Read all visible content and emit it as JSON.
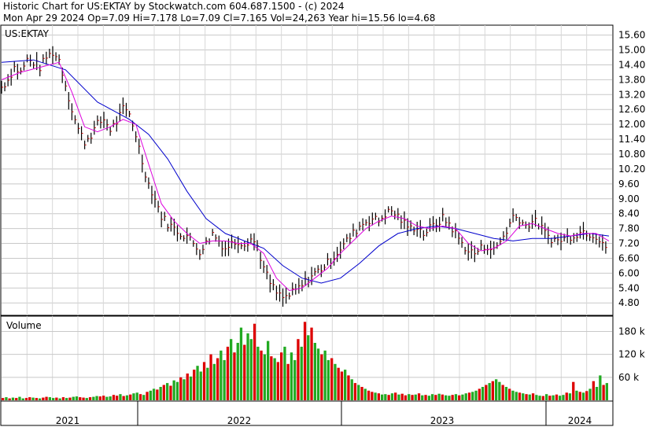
{
  "header": {
    "line1": "Historic Chart for US:EKTAY by Stockwatch.com 604.687.1500 - (c) 2024",
    "line2": "Mon Apr 29 2024  Op=7.09  Hi=7.178  Lo=7.09  Cl=7.165  Vol=24,263  Year hi=15.56  lo=4.68"
  },
  "chart_data": [
    {
      "type": "line",
      "subtype": "ohlc-bars-with-moving-averages",
      "title": "US:EKTAY",
      "ylim": [
        4.3,
        16.0
      ],
      "y_ticks": [
        4.8,
        5.4,
        6.0,
        6.6,
        7.2,
        7.8,
        8.4,
        9.0,
        9.6,
        10.2,
        10.8,
        11.4,
        12.0,
        12.6,
        13.2,
        13.8,
        14.4,
        15.0,
        15.6
      ],
      "y_tick_labels": [
        "4.80",
        "5.40",
        "6.00",
        "6.60",
        "7.20",
        "7.80",
        "8.40",
        "9.00",
        "9.60",
        "10.20",
        "10.80",
        "11.40",
        "12.00",
        "12.60",
        "13.20",
        "13.80",
        "14.40",
        "15.00",
        "15.60"
      ],
      "x_range": [
        0,
        100
      ],
      "grid": true,
      "colors": {
        "bars": "#000000",
        "bar_ticks": "#cc0000",
        "ma_short": "#dd00dd",
        "ma_long": "#0000cc",
        "grid": "#c8c8c8"
      },
      "price": [
        [
          0,
          13.5
        ],
        [
          2,
          13.8
        ],
        [
          4,
          14.3
        ],
        [
          6,
          14.1
        ],
        [
          8,
          14.6
        ],
        [
          10,
          14.5
        ],
        [
          12,
          14.3
        ],
        [
          14,
          14.7
        ],
        [
          16,
          14.9
        ],
        [
          18,
          14.6
        ],
        [
          20,
          13.6
        ],
        [
          22,
          12.6
        ],
        [
          24,
          11.8
        ],
        [
          26,
          11.3
        ],
        [
          28,
          11.6
        ],
        [
          30,
          12.0
        ],
        [
          32,
          12.2
        ],
        [
          34,
          11.8
        ],
        [
          36,
          12.1
        ],
        [
          38,
          12.6
        ],
        [
          40,
          12.4
        ],
        [
          42,
          11.6
        ],
        [
          44,
          10.5
        ],
        [
          46,
          9.6
        ],
        [
          48,
          9.0
        ],
        [
          50,
          8.3
        ],
        [
          52,
          8.0
        ],
        [
          54,
          7.8
        ],
        [
          56,
          7.6
        ],
        [
          58,
          7.5
        ],
        [
          60,
          7.2
        ],
        [
          62,
          6.9
        ],
        [
          64,
          7.2
        ],
        [
          66,
          7.6
        ],
        [
          68,
          7.3
        ],
        [
          70,
          7.0
        ],
        [
          72,
          7.2
        ],
        [
          74,
          7.3
        ],
        [
          76,
          7.2
        ],
        [
          78,
          7.4
        ],
        [
          80,
          7.1
        ],
        [
          82,
          6.2
        ],
        [
          84,
          5.6
        ],
        [
          86,
          5.2
        ],
        [
          88,
          5.0
        ],
        [
          90,
          5.1
        ],
        [
          92,
          5.3
        ],
        [
          94,
          5.5
        ],
        [
          96,
          5.8
        ],
        [
          98,
          6.0
        ],
        [
          100,
          6.2
        ],
        [
          102,
          6.4
        ],
        [
          104,
          6.7
        ],
        [
          106,
          7.0
        ],
        [
          108,
          7.3
        ],
        [
          110,
          7.6
        ],
        [
          112,
          7.9
        ],
        [
          114,
          8.1
        ],
        [
          116,
          8.2
        ],
        [
          118,
          8.1
        ],
        [
          120,
          8.4
        ],
        [
          122,
          8.5
        ],
        [
          124,
          8.3
        ],
        [
          126,
          8.0
        ],
        [
          128,
          7.8
        ],
        [
          130,
          7.9
        ],
        [
          132,
          7.6
        ],
        [
          134,
          7.8
        ],
        [
          136,
          8.0
        ],
        [
          138,
          8.2
        ],
        [
          140,
          8.0
        ],
        [
          142,
          7.6
        ],
        [
          144,
          7.2
        ],
        [
          146,
          6.9
        ],
        [
          148,
          6.8
        ],
        [
          150,
          7.0
        ],
        [
          152,
          7.1
        ],
        [
          154,
          6.9
        ],
        [
          156,
          7.3
        ],
        [
          158,
          7.7
        ],
        [
          160,
          8.3
        ],
        [
          162,
          8.2
        ],
        [
          164,
          7.9
        ],
        [
          166,
          8.1
        ],
        [
          168,
          8.0
        ],
        [
          170,
          7.6
        ],
        [
          172,
          7.4
        ],
        [
          174,
          7.3
        ],
        [
          176,
          7.4
        ],
        [
          178,
          7.5
        ],
        [
          180,
          7.6
        ],
        [
          182,
          7.7
        ],
        [
          184,
          7.6
        ],
        [
          186,
          7.5
        ],
        [
          188,
          7.3
        ],
        [
          190,
          6.8
        ]
      ],
      "ma_short": [
        [
          0,
          13.8
        ],
        [
          6,
          14.1
        ],
        [
          12,
          14.3
        ],
        [
          18,
          14.5
        ],
        [
          22,
          13.3
        ],
        [
          26,
          11.9
        ],
        [
          30,
          11.7
        ],
        [
          34,
          11.9
        ],
        [
          38,
          12.2
        ],
        [
          42,
          12.0
        ],
        [
          46,
          10.4
        ],
        [
          50,
          8.8
        ],
        [
          54,
          8.1
        ],
        [
          58,
          7.6
        ],
        [
          62,
          7.2
        ],
        [
          66,
          7.3
        ],
        [
          70,
          7.3
        ],
        [
          74,
          7.2
        ],
        [
          78,
          7.2
        ],
        [
          82,
          6.8
        ],
        [
          86,
          5.8
        ],
        [
          90,
          5.3
        ],
        [
          94,
          5.4
        ],
        [
          98,
          5.8
        ],
        [
          102,
          6.2
        ],
        [
          106,
          6.8
        ],
        [
          110,
          7.3
        ],
        [
          114,
          7.8
        ],
        [
          118,
          8.1
        ],
        [
          122,
          8.3
        ],
        [
          126,
          8.2
        ],
        [
          130,
          7.9
        ],
        [
          134,
          7.8
        ],
        [
          138,
          7.9
        ],
        [
          142,
          7.8
        ],
        [
          146,
          7.2
        ],
        [
          150,
          6.9
        ],
        [
          154,
          7.0
        ],
        [
          158,
          7.3
        ],
        [
          162,
          7.9
        ],
        [
          166,
          8.0
        ],
        [
          170,
          7.8
        ],
        [
          174,
          7.6
        ],
        [
          178,
          7.5
        ],
        [
          182,
          7.6
        ],
        [
          186,
          7.6
        ],
        [
          190,
          7.3
        ]
      ],
      "ma_long": [
        [
          0,
          14.5
        ],
        [
          10,
          14.6
        ],
        [
          20,
          14.2
        ],
        [
          30,
          12.9
        ],
        [
          40,
          12.2
        ],
        [
          46,
          11.6
        ],
        [
          52,
          10.6
        ],
        [
          58,
          9.3
        ],
        [
          64,
          8.2
        ],
        [
          70,
          7.6
        ],
        [
          76,
          7.3
        ],
        [
          82,
          7.0
        ],
        [
          88,
          6.3
        ],
        [
          94,
          5.8
        ],
        [
          100,
          5.6
        ],
        [
          106,
          5.8
        ],
        [
          112,
          6.4
        ],
        [
          118,
          7.1
        ],
        [
          124,
          7.6
        ],
        [
          130,
          7.8
        ],
        [
          136,
          7.9
        ],
        [
          142,
          7.8
        ],
        [
          148,
          7.6
        ],
        [
          154,
          7.4
        ],
        [
          160,
          7.3
        ],
        [
          166,
          7.4
        ],
        [
          172,
          7.4
        ],
        [
          178,
          7.5
        ],
        [
          184,
          7.6
        ],
        [
          190,
          7.5
        ]
      ]
    },
    {
      "type": "bar",
      "title": "Volume",
      "ylim": [
        0,
        220
      ],
      "y_ticks": [
        60,
        120,
        180
      ],
      "y_tick_labels": [
        "60 k",
        "120 k",
        "180 k"
      ],
      "x_ticks_years": [
        "2021",
        "2022",
        "2023",
        "2024"
      ],
      "colors": {
        "up": "#22aa22",
        "down": "#dd0000"
      },
      "volume": [
        6,
        8,
        5,
        7,
        6,
        9,
        5,
        6,
        8,
        7,
        6,
        5,
        7,
        9,
        8,
        6,
        7,
        5,
        8,
        6,
        7,
        9,
        10,
        8,
        7,
        6,
        8,
        9,
        11,
        10,
        12,
        9,
        10,
        14,
        12,
        16,
        11,
        13,
        15,
        18,
        20,
        16,
        14,
        22,
        25,
        30,
        28,
        35,
        40,
        45,
        38,
        52,
        48,
        60,
        55,
        70,
        62,
        80,
        90,
        75,
        100,
        85,
        120,
        95,
        110,
        130,
        105,
        140,
        160,
        125,
        150,
        190,
        145,
        175,
        160,
        200,
        140,
        130,
        120,
        155,
        115,
        110,
        100,
        125,
        140,
        95,
        125,
        105,
        160,
        140,
        205,
        170,
        190,
        150,
        135,
        120,
        130,
        105,
        110,
        95,
        85,
        75,
        80,
        65,
        55,
        45,
        40,
        35,
        30,
        25,
        22,
        20,
        18,
        15,
        16,
        14,
        18,
        20,
        15,
        17,
        13,
        16,
        14,
        15,
        18,
        13,
        14,
        12,
        16,
        14,
        17,
        15,
        13,
        12,
        14,
        16,
        13,
        15,
        18,
        20,
        22,
        25,
        30,
        35,
        40,
        45,
        50,
        55,
        48,
        40,
        35,
        30,
        25,
        22,
        20,
        18,
        16,
        15,
        18,
        14,
        12,
        11,
        16,
        12,
        13,
        15,
        12,
        14,
        20,
        18,
        48,
        25,
        22,
        20,
        24,
        30,
        50,
        35,
        65,
        40,
        45
      ],
      "volume_up": [
        0,
        1,
        0,
        1,
        0,
        1,
        1,
        0,
        0,
        1,
        0,
        1,
        0,
        0,
        1,
        1,
        0,
        1,
        0,
        1,
        0,
        1,
        1,
        0,
        0,
        1,
        0,
        1,
        1,
        0,
        0,
        1,
        1,
        0,
        0,
        1,
        0,
        1,
        0,
        1,
        1,
        0,
        1,
        0,
        1,
        1,
        0,
        1,
        0,
        1,
        0,
        1,
        1,
        0,
        1,
        0,
        1,
        0,
        1,
        1,
        0,
        1,
        0,
        1,
        0,
        1,
        1,
        0,
        1,
        0,
        1,
        1,
        0,
        1,
        1,
        0,
        1,
        0,
        1,
        1,
        0,
        1,
        0,
        0,
        1,
        0,
        1,
        1,
        0,
        1,
        0,
        1,
        0,
        1,
        1,
        0,
        1,
        1,
        0,
        1,
        0,
        0,
        1,
        0,
        1,
        0,
        1,
        0,
        1,
        0,
        0,
        1,
        0,
        1,
        1,
        0,
        1,
        0,
        1,
        0,
        0,
        1,
        0,
        1,
        0,
        1,
        0,
        1,
        1,
        0,
        1,
        0,
        1,
        1,
        0,
        1,
        0,
        1,
        1,
        0,
        1,
        1,
        0,
        1,
        0,
        1,
        0,
        1,
        1,
        0,
        1,
        0,
        1,
        1,
        0,
        1,
        0,
        1,
        0,
        1,
        1,
        0,
        1,
        0,
        1,
        0,
        1,
        1,
        0,
        1,
        0,
        1,
        0,
        1,
        0,
        1,
        0,
        1,
        1,
        0,
        1,
        0,
        1,
        0,
        1,
        1,
        0,
        1,
        1
      ]
    }
  ]
}
